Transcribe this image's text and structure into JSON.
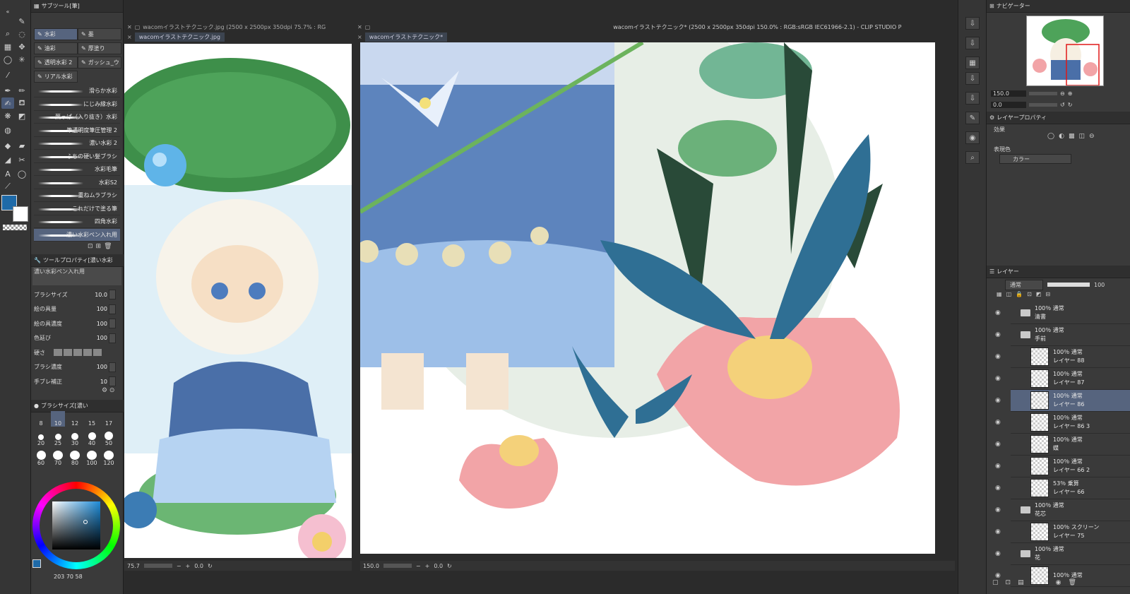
{
  "subtool": {
    "header": "サブツール[筆]",
    "groups": [
      "水彩",
      "墨",
      "油彩",
      "厚塗り",
      "透明水彩 2",
      "ガッシュ_ウ",
      "リアル水彩"
    ],
    "brushes": [
      "滑らか水彩",
      "にじみ縁水彩",
      "葉っぱ（入り抜き）水彩",
      "筆透明度筆圧管理 2",
      "濃い水彩 2",
      "ふちの硬い髪ブラシ",
      "水彩毛筆",
      "水彩S2",
      "重ねムラブラシ",
      "これだけで塗る筆",
      "四角水彩",
      "濃い水彩ペン入れ用"
    ]
  },
  "toolprop": {
    "header": "ツールプロパティ[濃い水彩",
    "brush_name": "濃い水彩ペン入れ用",
    "rows": [
      {
        "label": "ブラシサイズ",
        "value": "10.0"
      },
      {
        "label": "絵の具量",
        "value": "100"
      },
      {
        "label": "絵の具濃度",
        "value": "100"
      },
      {
        "label": "色延び",
        "value": "100"
      },
      {
        "label": "硬さ",
        "value": ""
      },
      {
        "label": "ブラシ濃度",
        "value": "100"
      },
      {
        "label": "手ブレ補正",
        "value": "10"
      }
    ]
  },
  "brushsize": {
    "header": "ブラシサイズ[濃い",
    "sizes": [
      "8",
      "10",
      "12",
      "15",
      "17",
      "20",
      "25",
      "30",
      "40",
      "50",
      "60",
      "70",
      "80",
      "100",
      "120"
    ]
  },
  "colorwheel": {
    "readout": "203  70  58",
    "main_color": "#1e6aa8"
  },
  "canvasA": {
    "tab": "wacomイラストテクニック.jpg (2500 x 2500px 350dpi 75.7% : RG",
    "subtab": "wacomイラストテクニック.jpg",
    "zoom": "75.7",
    "angle": "0.0"
  },
  "canvasB": {
    "title": "wacomイラストテクニック* (2500 x 2500px 350dpi 150.0% : RGB:sRGB IEC61966-2.1) - CLIP STUDIO P",
    "tab": "wacomイラストテクニック*",
    "zoom": "150.0",
    "angle": "0.0"
  },
  "navigator": {
    "header": "ナビゲーター",
    "zoom": "150.0",
    "angle": "0.0"
  },
  "layerprop": {
    "header": "レイヤープロパティ",
    "effect_label": "効果",
    "color_label": "表現色",
    "color_value": "カラー"
  },
  "layers": {
    "header": "レイヤー",
    "blend": "通常",
    "opacity": "100",
    "items": [
      {
        "mode": "100％ 通常",
        "name": "清書",
        "type": "folder"
      },
      {
        "mode": "100％ 通常",
        "name": "手前",
        "type": "folder"
      },
      {
        "mode": "100％ 通常",
        "name": "レイヤー 88",
        "type": "layer"
      },
      {
        "mode": "100％ 通常",
        "name": "レイヤー 87",
        "type": "layer"
      },
      {
        "mode": "100％ 通常",
        "name": "レイヤー 86",
        "type": "layer"
      },
      {
        "mode": "100％ 通常",
        "name": "レイヤー 86 3",
        "type": "layer"
      },
      {
        "mode": "100％ 通常",
        "name": "蝶",
        "type": "layer"
      },
      {
        "mode": "100％ 通常",
        "name": "レイヤー 66 2",
        "type": "layer"
      },
      {
        "mode": "53％ 乗算",
        "name": "レイヤー 66",
        "type": "layer"
      },
      {
        "mode": "100％ 通常",
        "name": "花芯",
        "type": "folder"
      },
      {
        "mode": "100％ スクリーン",
        "name": "レイヤー 75",
        "type": "layer"
      },
      {
        "mode": "100％ 通常",
        "name": "花",
        "type": "folder"
      },
      {
        "mode": "100％ 通常",
        "name": "",
        "type": "layer"
      }
    ]
  }
}
